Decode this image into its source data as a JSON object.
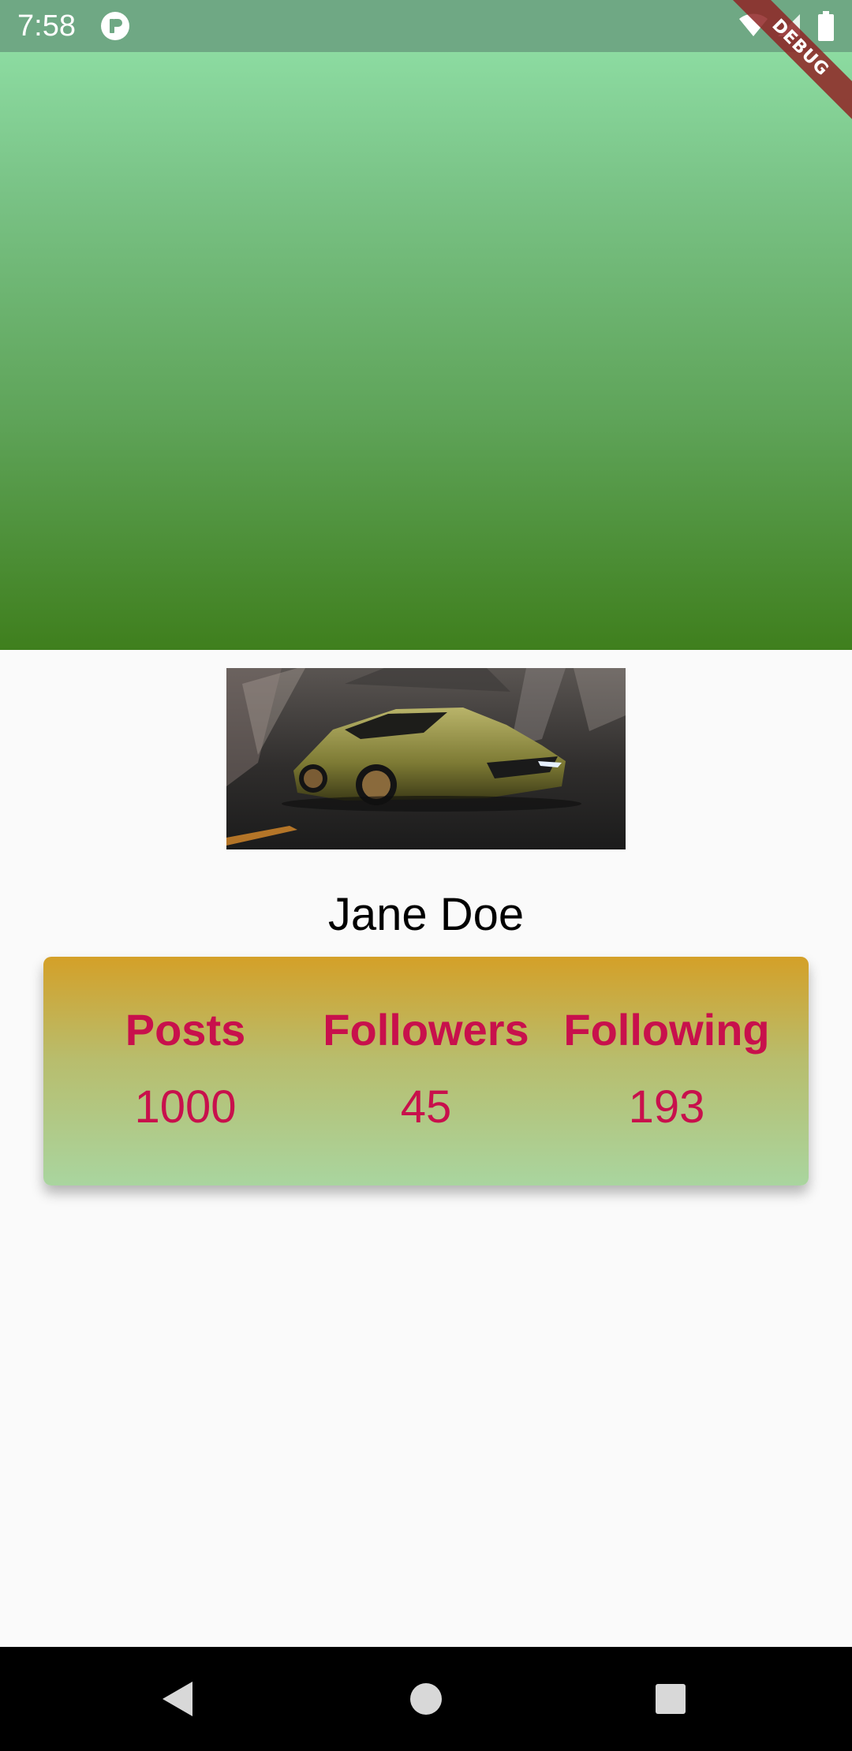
{
  "status_bar": {
    "time": "7:58",
    "icons": [
      "app-notification-icon",
      "wifi-icon",
      "signal-icon",
      "battery-icon"
    ]
  },
  "debug_banner": {
    "label": "DEBUG"
  },
  "header": {
    "gradient_colors": [
      "#93e4ab",
      "#79c285",
      "#5ea358",
      "#3f7f1d"
    ]
  },
  "profile": {
    "picture_icon": "sports-car-image",
    "name": "Jane Doe"
  },
  "stats": {
    "card_gradient": [
      "#d4a028",
      "#a9d59f"
    ],
    "text_color": "#c8104c",
    "items": [
      {
        "label": "Posts",
        "value": "1000"
      },
      {
        "label": "Followers",
        "value": "45"
      },
      {
        "label": "Following",
        "value": "193"
      }
    ]
  },
  "nav_bar": {
    "icons": [
      "back-icon",
      "home-icon",
      "recents-icon"
    ]
  }
}
